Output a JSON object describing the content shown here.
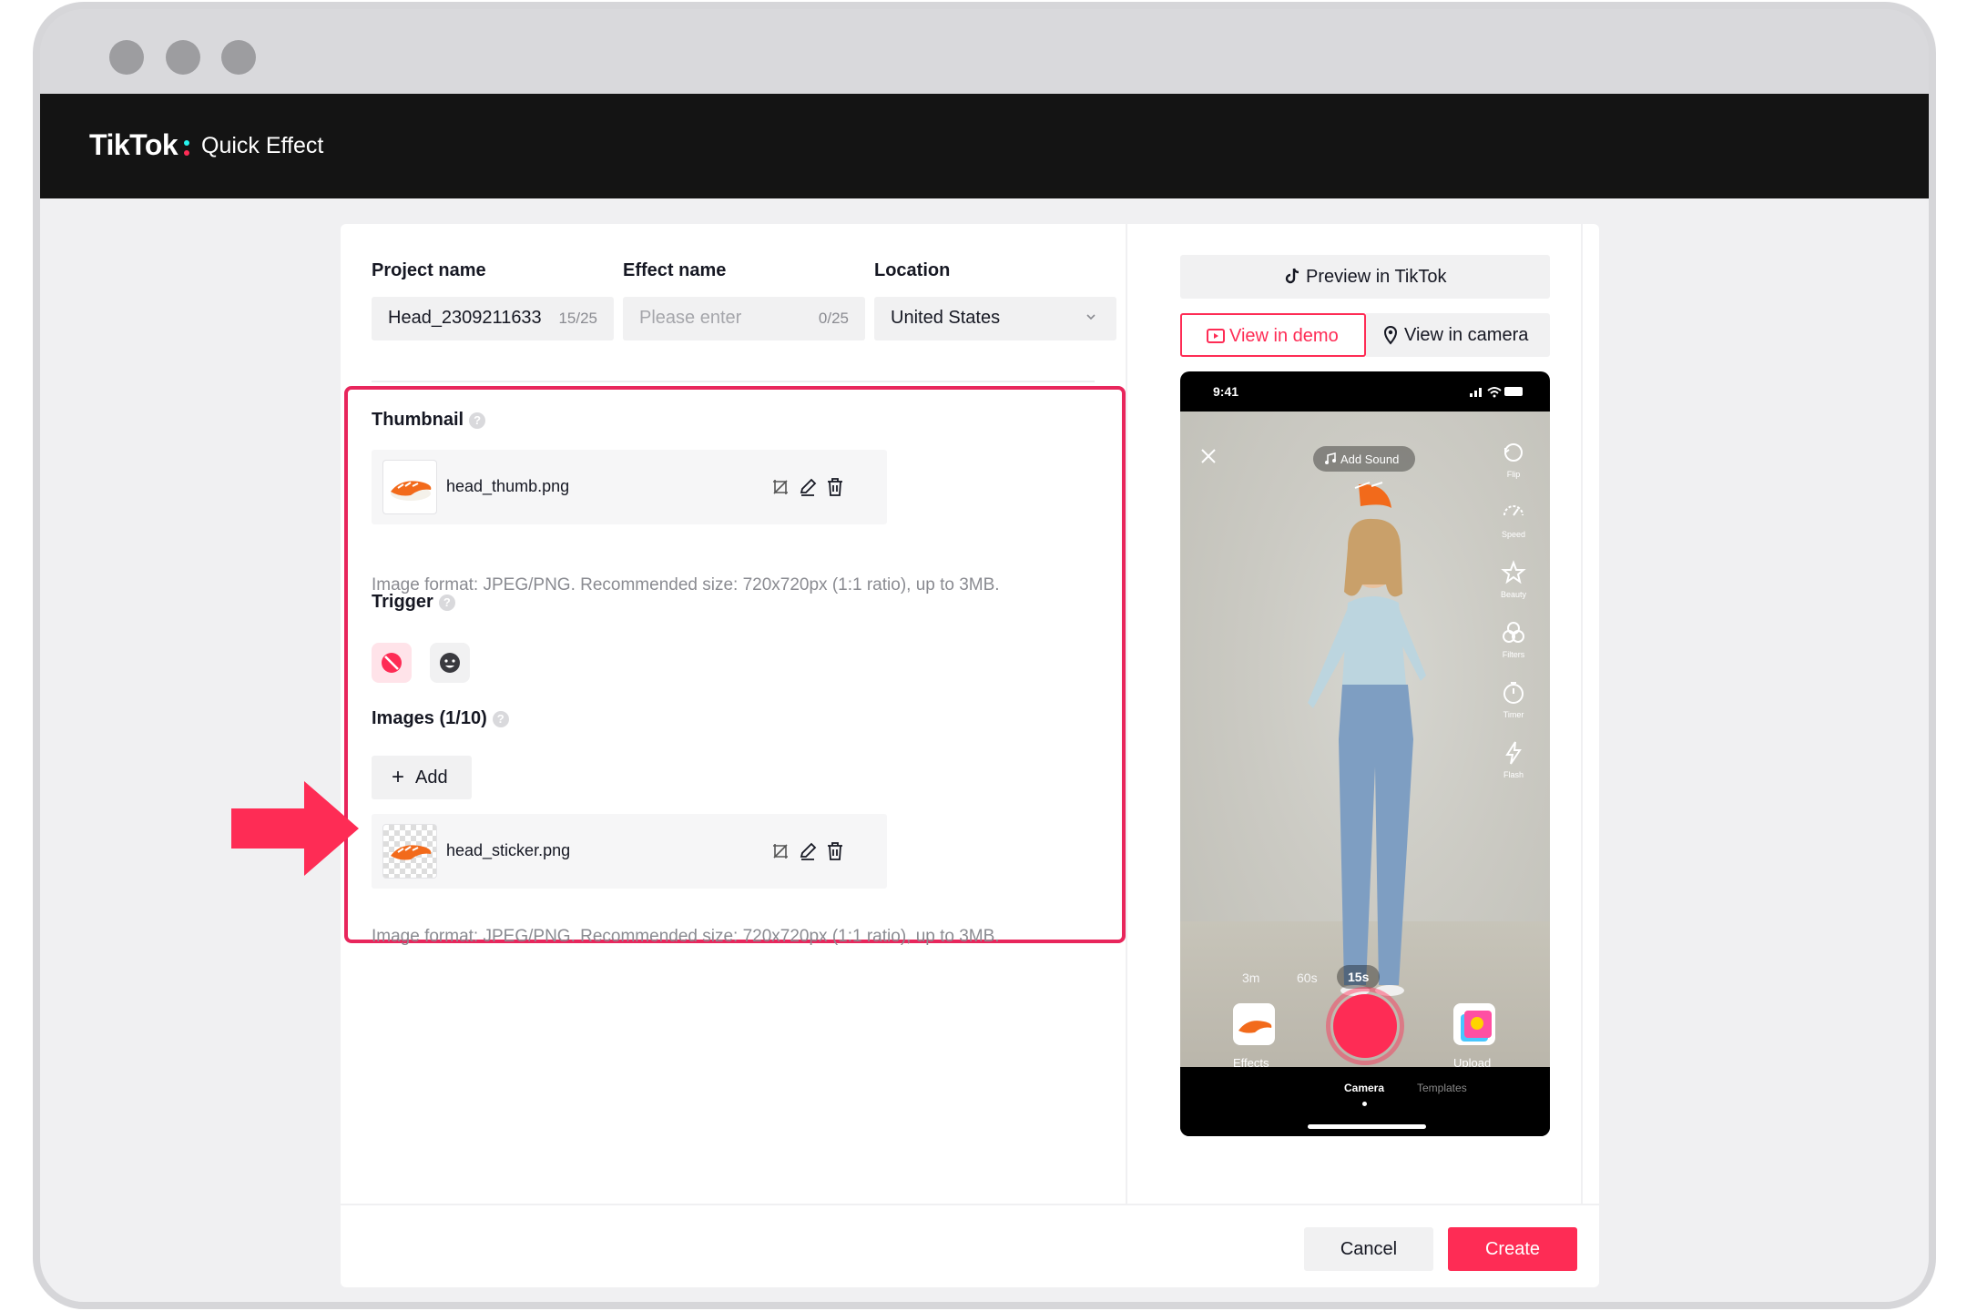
{
  "app": {
    "brand": "TikTok",
    "product": "Quick Effect"
  },
  "form": {
    "project_name": {
      "label": "Project name",
      "value": "Head_2309211633",
      "counter": "15/25"
    },
    "effect_name": {
      "label": "Effect name",
      "placeholder": "Please enter",
      "counter": "0/25"
    },
    "location": {
      "label": "Location",
      "value": "United States"
    }
  },
  "thumbnail": {
    "label": "Thumbnail",
    "file_name": "head_thumb.png",
    "hint": "Image format: JPEG/PNG. Recommended size: 720x720px (1:1 ratio), up to 3MB."
  },
  "trigger": {
    "label": "Trigger",
    "options": [
      "none-icon",
      "face-icon"
    ],
    "selected": "none-icon"
  },
  "images": {
    "label": "Images (1/10)",
    "add_label": "Add",
    "file_name": "head_sticker.png",
    "hint": "Image format: JPEG/PNG. Recommended size: 720x720px (1:1 ratio), up to 3MB."
  },
  "preview": {
    "preview_button": "Preview in TikTok",
    "view_demo": "View in demo",
    "view_camera": "View in camera",
    "phone": {
      "time": "9:41",
      "add_sound": "Add Sound",
      "side_tools": [
        "Flip",
        "Speed",
        "Beauty",
        "Filters",
        "Timer",
        "Flash"
      ],
      "durations": [
        "3m",
        "60s",
        "15s"
      ],
      "selected_duration": "15s",
      "effects_label": "Effects",
      "upload_label": "Upload",
      "tabs": [
        "Camera",
        "Templates"
      ],
      "active_tab": "Camera"
    }
  },
  "footer": {
    "cancel": "Cancel",
    "create": "Create"
  },
  "colors": {
    "accent": "#fe2c55",
    "highlight": "#e8265c",
    "topbar": "#141414"
  }
}
